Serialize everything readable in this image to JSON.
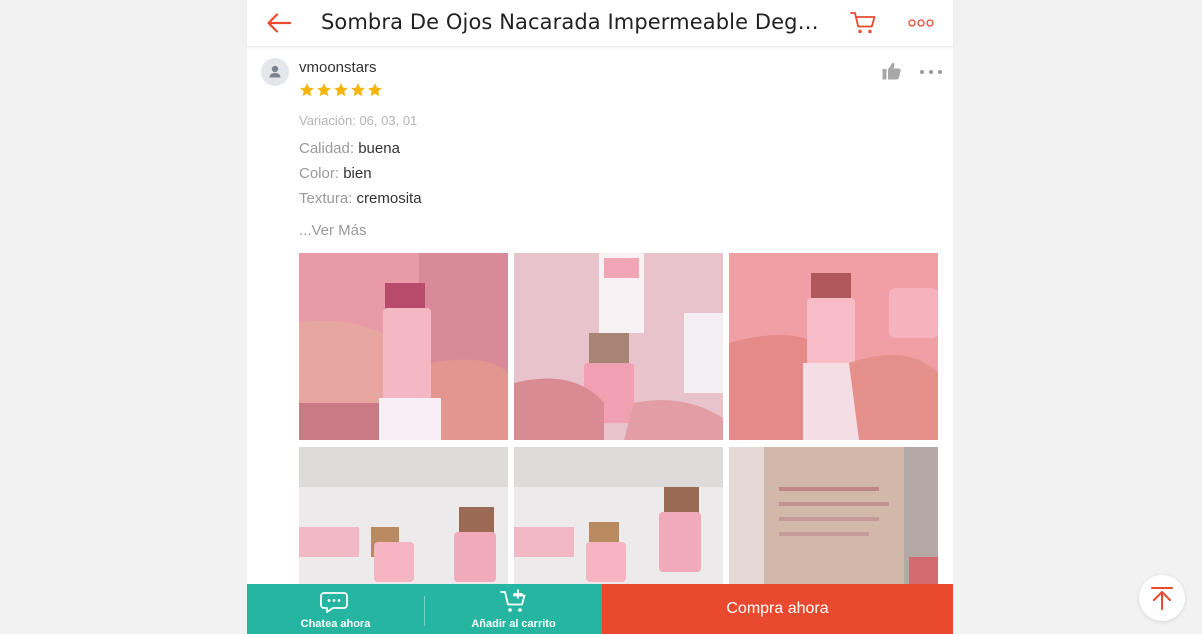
{
  "header": {
    "title": "Sombra De Ojos Nacarada Impermeable Degr...",
    "back_icon": "arrow-left-icon",
    "cart_icon": "cart-icon",
    "more_icon": "more-dots-icon",
    "accent_color": "#e8492f"
  },
  "review": {
    "username": "vmoonstars",
    "rating": 5,
    "rating_max": 5,
    "star_color": "#f5b50a",
    "variation": "Variación: 06, 03, 01",
    "attributes": [
      {
        "key": "Calidad:",
        "value": "buena"
      },
      {
        "key": "Color:",
        "value": "bien"
      },
      {
        "key": "Textura:",
        "value": "cremosita"
      }
    ],
    "see_more": "...Ver Más",
    "photo_count_visible": 6
  },
  "bottom_bar": {
    "chat_label": "Chatea ahora",
    "add_cart_label": "Añadir al carrito",
    "buy_label": "Compra ahora",
    "secondary_color": "#26b5a1",
    "primary_color": "#e8492f"
  },
  "scroll_top_icon": "arrow-to-top-icon"
}
